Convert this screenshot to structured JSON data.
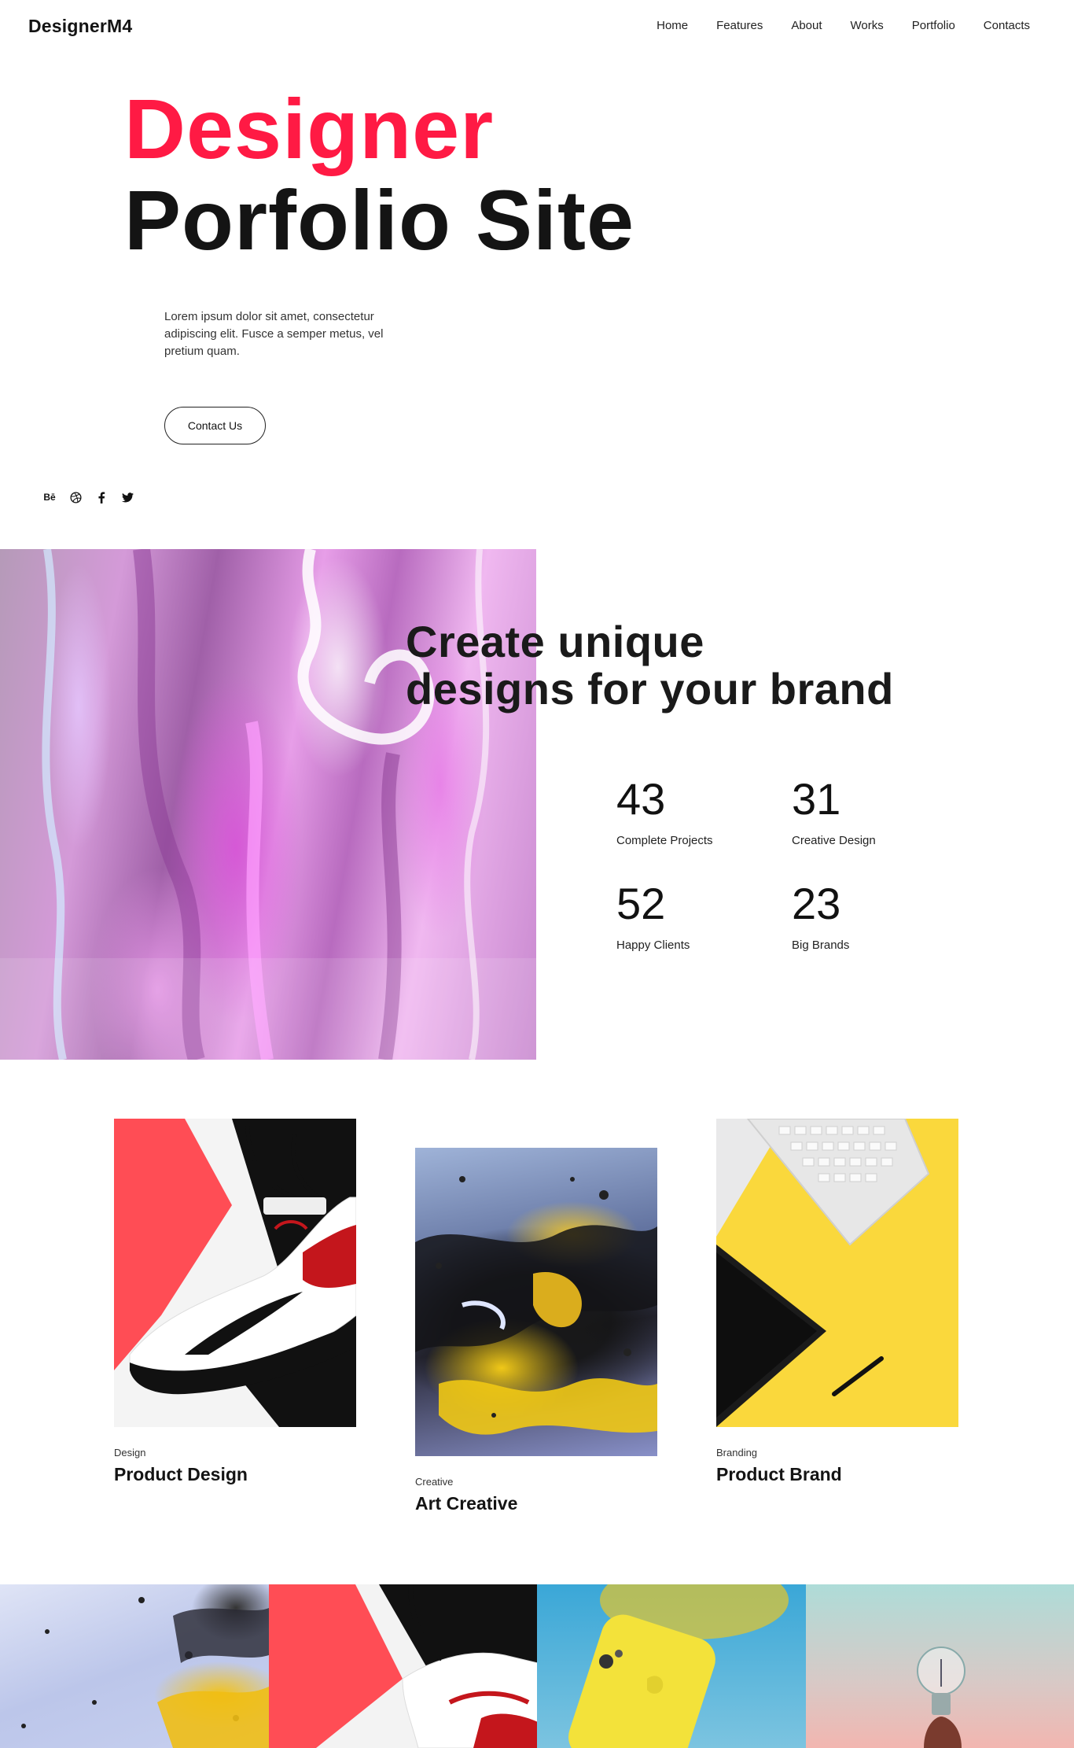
{
  "header": {
    "logo": "DesignerM4",
    "nav": [
      "Home",
      "Features",
      "About",
      "Works",
      "Portfolio",
      "Contacts"
    ]
  },
  "hero": {
    "title_line1": "Designer",
    "title_line2": "Porfolio Site",
    "text": "Lorem ipsum dolor sit amet, consectetur adipiscing elit. Fusce a semper metus, vel pretium quam.",
    "button": "Contact Us",
    "socials": [
      "behance-icon",
      "dribbble-icon",
      "facebook-icon",
      "twitter-icon"
    ],
    "behance_label": "Bē",
    "accent_color": "#ff1a44"
  },
  "feature": {
    "title_line1": "Create unique",
    "title_line2": "designs for your brand",
    "stats": [
      {
        "value": "43",
        "label": "Complete Projects"
      },
      {
        "value": "31",
        "label": "Creative Design"
      },
      {
        "value": "52",
        "label": "Happy Clients"
      },
      {
        "value": "23",
        "label": "Big Brands"
      }
    ]
  },
  "portfolio": [
    {
      "category": "Design",
      "title": "Product Design",
      "image": "sneaker-photo"
    },
    {
      "category": "Creative",
      "title": "Art Creative",
      "image": "fluid-art-photo"
    },
    {
      "category": "Branding",
      "title": "Product Brand",
      "image": "keyboard-tablet-photo"
    }
  ],
  "gallery": [
    "fluid-art-photo",
    "sneaker-photo",
    "yellow-phone-photo",
    "lightbulb-photo"
  ]
}
